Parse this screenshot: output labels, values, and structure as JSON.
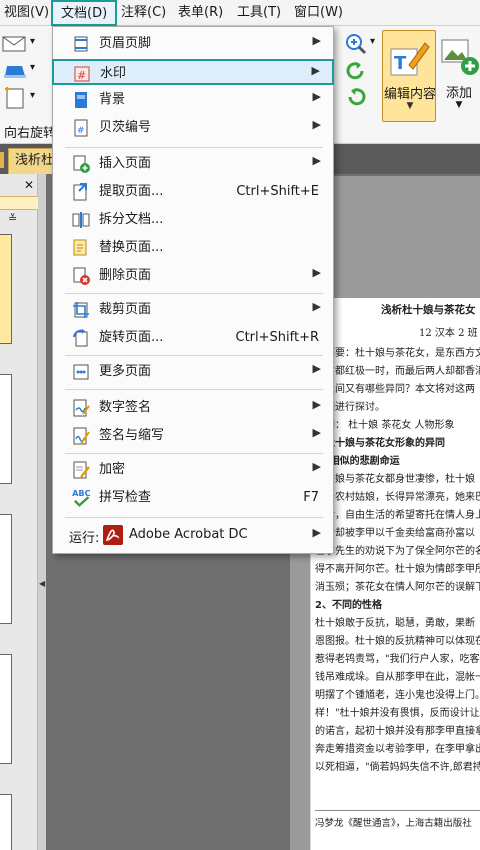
{
  "menubar": {
    "items": [
      "视图(V)",
      "文档(D)",
      "注释(C)",
      "表单(R)",
      "工具(T)",
      "窗口(W)"
    ]
  },
  "toolbar": {
    "rotate_label": "向右旋转",
    "edit_content_label": "编辑内容",
    "add_label": "添加"
  },
  "tab": {
    "title": "浅析杜"
  },
  "document_menu": {
    "items": [
      {
        "label": "页眉页脚",
        "shortcut": "",
        "submenu": true
      },
      {
        "label": "水印",
        "shortcut": "",
        "submenu": true
      },
      {
        "label": "背景",
        "shortcut": "",
        "submenu": true
      },
      {
        "label": "贝茨编号",
        "shortcut": "",
        "submenu": true
      },
      {
        "label": "插入页面",
        "shortcut": "",
        "submenu": true
      },
      {
        "label": "提取页面...",
        "shortcut": "Ctrl+Shift+E",
        "submenu": false
      },
      {
        "label": "拆分文档...",
        "shortcut": "",
        "submenu": false
      },
      {
        "label": "替换页面...",
        "shortcut": "",
        "submenu": false
      },
      {
        "label": "删除页面",
        "shortcut": "",
        "submenu": true
      },
      {
        "label": "裁剪页面",
        "shortcut": "",
        "submenu": true
      },
      {
        "label": "旋转页面...",
        "shortcut": "Ctrl+Shift+R",
        "submenu": false
      },
      {
        "label": "更多页面",
        "shortcut": "",
        "submenu": true
      },
      {
        "label": "数字签名",
        "shortcut": "",
        "submenu": true
      },
      {
        "label": "签名与缩写",
        "shortcut": "",
        "submenu": true
      },
      {
        "label": "加密",
        "shortcut": "",
        "submenu": true
      },
      {
        "label": "拼写检查",
        "shortcut": "F7",
        "submenu": false
      }
    ],
    "run_label": "运行:",
    "run_app": "Adobe Acrobat DC",
    "spell_icon_text": "ABC"
  },
  "document": {
    "title": "浅析杜十娘与茶花女",
    "author": "12 汉本 2 班",
    "lines": [
      "容摘要：杜十娘与茶花女，是东西方文",
      "是甘都红极一时，而最后两人却都香消",
      "间之间又有哪些异同？本文将对这两",
      "原因进行探讨。",
      "键词：   杜十娘   茶花女   人物形象",
      "、杜十娘与茶花女形象的异同",
      "一)相似的悲剧命运",
      "    杜十娘与茶花女都身世凄惨，杜十娘",
      "是个农村姑娘，长得异常漂亮，她来巴",
      "生活，自由生活的希望寄托在情人身上",
      "最后却被李甲以千金卖给富商孙富以",
      "甚尔先生的劝说下为了保全阿尔芒的名",
      "得不离开阿尔芒。杜十娘为情郎李甲所",
      "消玉殒；茶花女在情人阿尔芒的误解下",
      "2、不同的性格",
      "    杜十娘敢于反抗，聪慧，勇敢，果断",
      "恩图报。杜十娘的反抗精神可以体现在",
      "惹得老鸨责骂，\"我们行户人家，吃客穿",
      "钱吊难成垛。自从那李甲在此，混帐一年",
      "明摆了个锺馗老，连小鬼也没得上门。弄",
      "样！\"杜十娘并没有畏惧，反而设计让",
      "的诺言，起初十娘并没有那李甲直接拿出",
      "奔走筹措资金以考验李甲，在李甲拿出三",
      "以死相逼，\"倘若妈妈失信不许,郎君持"
    ],
    "footnote": "冯梦龙《醒世通言》，上海古籍出版社"
  }
}
